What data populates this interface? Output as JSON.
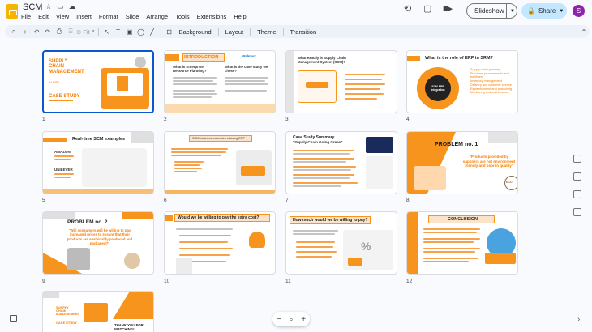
{
  "app": {
    "title": "SCM"
  },
  "menu": [
    "File",
    "Edit",
    "View",
    "Insert",
    "Format",
    "Slide",
    "Arrange",
    "Tools",
    "Extensions",
    "Help"
  ],
  "buttons": {
    "slideshow": "Slideshow",
    "share": "Share",
    "avatar_initial": "S"
  },
  "toolbar": {
    "fit": "Fit",
    "background": "Background",
    "layout": "Layout",
    "theme": "Theme",
    "transition": "Transition"
  },
  "colors": {
    "accent": "#f7941d",
    "selected": "#0b57d0",
    "share_bg": "#c2e7ff",
    "avatar": "#8e24aa"
  },
  "slides": [
    {
      "num": "1",
      "title_l1": "SUPPLY",
      "title_l2": "CHAIN",
      "title_l3": "MANAGEMENT",
      "sub": "IN SRP",
      "case": "CASE STUDY"
    },
    {
      "num": "2",
      "title": "INTRODUCTION",
      "q1": "What is Enterprise Resource Planning?",
      "q2": "What is the case study we chose?",
      "brand": "Walmart"
    },
    {
      "num": "3",
      "title": "What exactly is Supply Chain Management System (SCM)?"
    },
    {
      "num": "4",
      "title": "What is the role of ERP in SRM?",
      "center": "SCM-ERP Integration",
      "items": [
        "Supply chain planning",
        "Purchase procurements and fulfillment",
        "Inventory management",
        "Delivery and customer service",
        "Replenishment and restocking",
        "Monitoring and maintenance"
      ]
    },
    {
      "num": "5",
      "title": "Real-time SCM examples",
      "ex1": "AMAZON",
      "ex2": "UNILEVER"
    },
    {
      "num": "6",
      "title": "SCM business examples of using ERP"
    },
    {
      "num": "7",
      "title": "Case Study Summary",
      "subtitle": "\"Supply Chain Going Green\""
    },
    {
      "num": "8",
      "title": "PROBLEM no. 1",
      "quote": "\"Products provided by suppliers are not environment friendly and poor in quality\"",
      "badge": "ECO"
    },
    {
      "num": "9",
      "title": "PROBLEM no. 2",
      "quote": "\"Will consumers will be willing to pay increased prices to ensure that their products are sustainably produced and packaged?\""
    },
    {
      "num": "10",
      "title": "Would we be willing to pay the extra cost?"
    },
    {
      "num": "11",
      "title": "How much would we be willing to pay?"
    },
    {
      "num": "12",
      "title": "CONCLUSION"
    },
    {
      "num": "13",
      "title_l1": "SUPPLY",
      "title_l2": "CHAIN",
      "title_l3": "MANAGEMENT",
      "case": "CASE STUDY",
      "thanks_l1": "THANK YOU FOR",
      "thanks_l2": "WATCHING!"
    }
  ]
}
